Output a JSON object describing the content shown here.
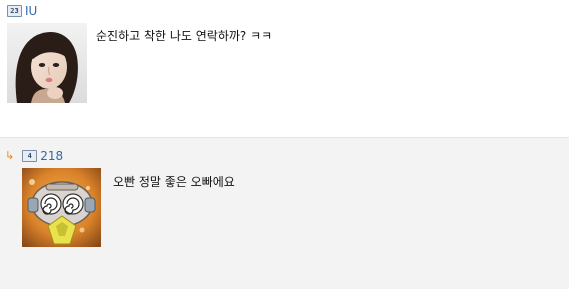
{
  "comments": [
    {
      "level_badge": "23",
      "author": "IU",
      "avatar": "avatar-woman-portrait",
      "text": "순진하고 착한 나도 연락하까? ㅋㅋ"
    },
    {
      "reply_icon": "↳",
      "level_badge": "4",
      "author": "218",
      "avatar": "avatar-cartoon-character",
      "text": "오빤 정말 좋은 오빠에요"
    }
  ],
  "colors": {
    "author_link": "#2e6aa8",
    "reply_arrow": "#e38a1d",
    "reply_background": "#f3f3f3"
  }
}
